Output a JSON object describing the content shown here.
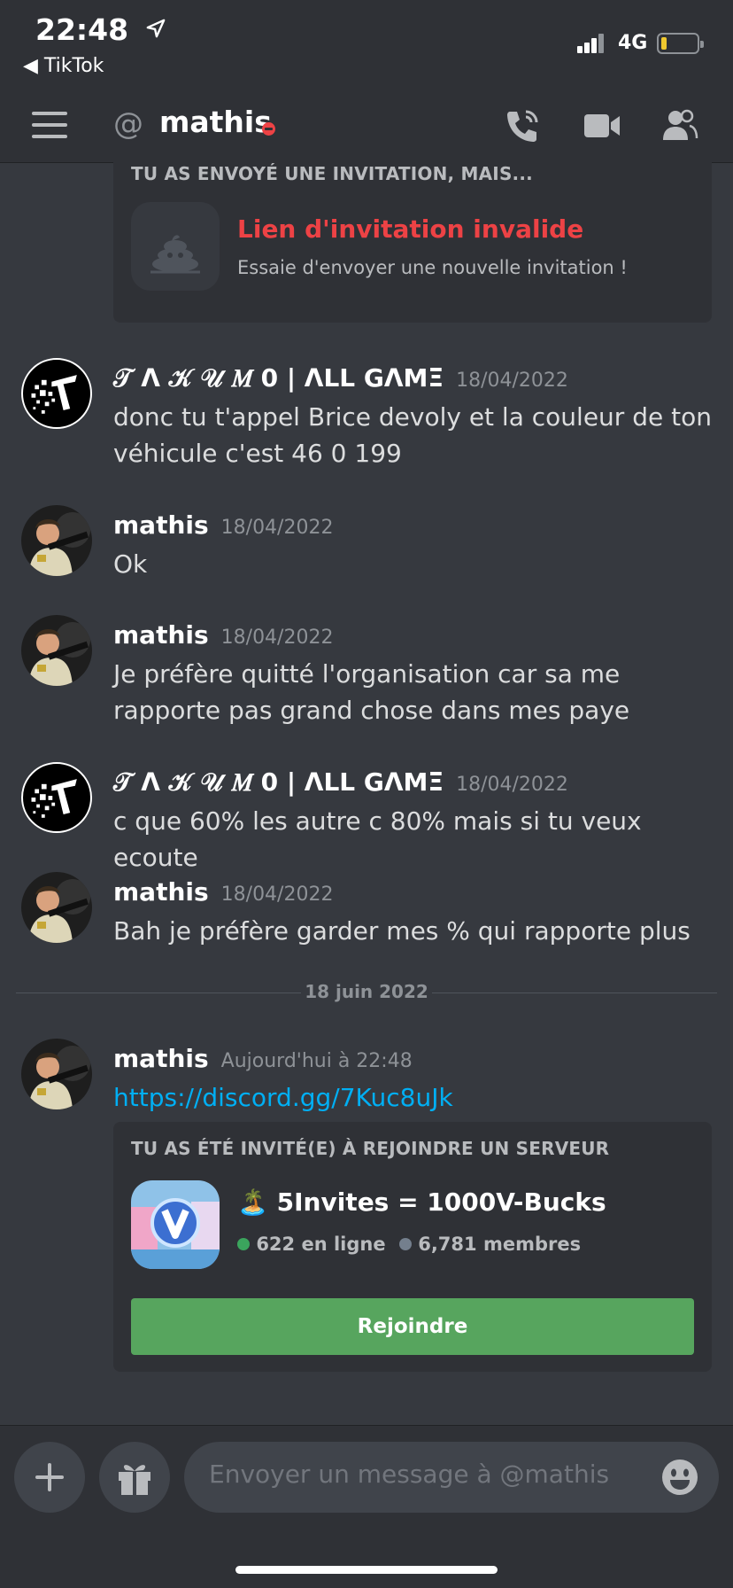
{
  "status_bar": {
    "time": "22:48",
    "back_app": "◀ TikTok",
    "network": "4G"
  },
  "header": {
    "at_symbol": "@",
    "name": "mathis"
  },
  "invalid_invite": {
    "title": "TU AS ENVOYÉ UNE INVITATION, MAIS...",
    "heading": "Lien d'invitation invalide",
    "subtext": "Essaie d'envoyer une nouvelle invitation !"
  },
  "messages": [
    {
      "author": "𝒯 ᐱ 𝒦 𝒰 𝑀 0 | ᐱLL GᐱMΞ",
      "time": "18/04/2022",
      "text": "donc tu t'appel  Brice devoly et la couleur de ton véhicule c'est 46 0 199"
    },
    {
      "author": "mathis",
      "time": "18/04/2022",
      "text": "Ok"
    },
    {
      "author": "mathis",
      "time": "18/04/2022",
      "text": "Je préfère quitté l'organisation car sa me rapporte pas grand chose dans mes paye"
    },
    {
      "author": "𝒯 ᐱ 𝒦 𝒰 𝑀 0 | ᐱLL GᐱMΞ",
      "time": "18/04/2022",
      "text": "c que 60% les autre c 80% mais si tu veux ecoute"
    },
    {
      "author": "mathis",
      "time": "18/04/2022",
      "text": "Bah je préfère garder mes % qui rapporte plus"
    }
  ],
  "date_divider": "18 juin 2022",
  "last_message": {
    "author": "mathis",
    "time": "Aujourd'hui à 22:48",
    "link": "https://discord.gg/7Kuc8uJk"
  },
  "server_invite": {
    "title": "TU AS ÉTÉ INVITÉ(E) À REJOINDRE UN SERVEUR",
    "server_emoji": "🏝️",
    "server_name": "5Invites = 1000V-Bucks",
    "online": "622 en ligne",
    "members": "6,781 membres",
    "join_label": "Rejoindre",
    "online_color": "#3ba55d"
  },
  "composer": {
    "placeholder": "Envoyer un message à @mathis"
  }
}
